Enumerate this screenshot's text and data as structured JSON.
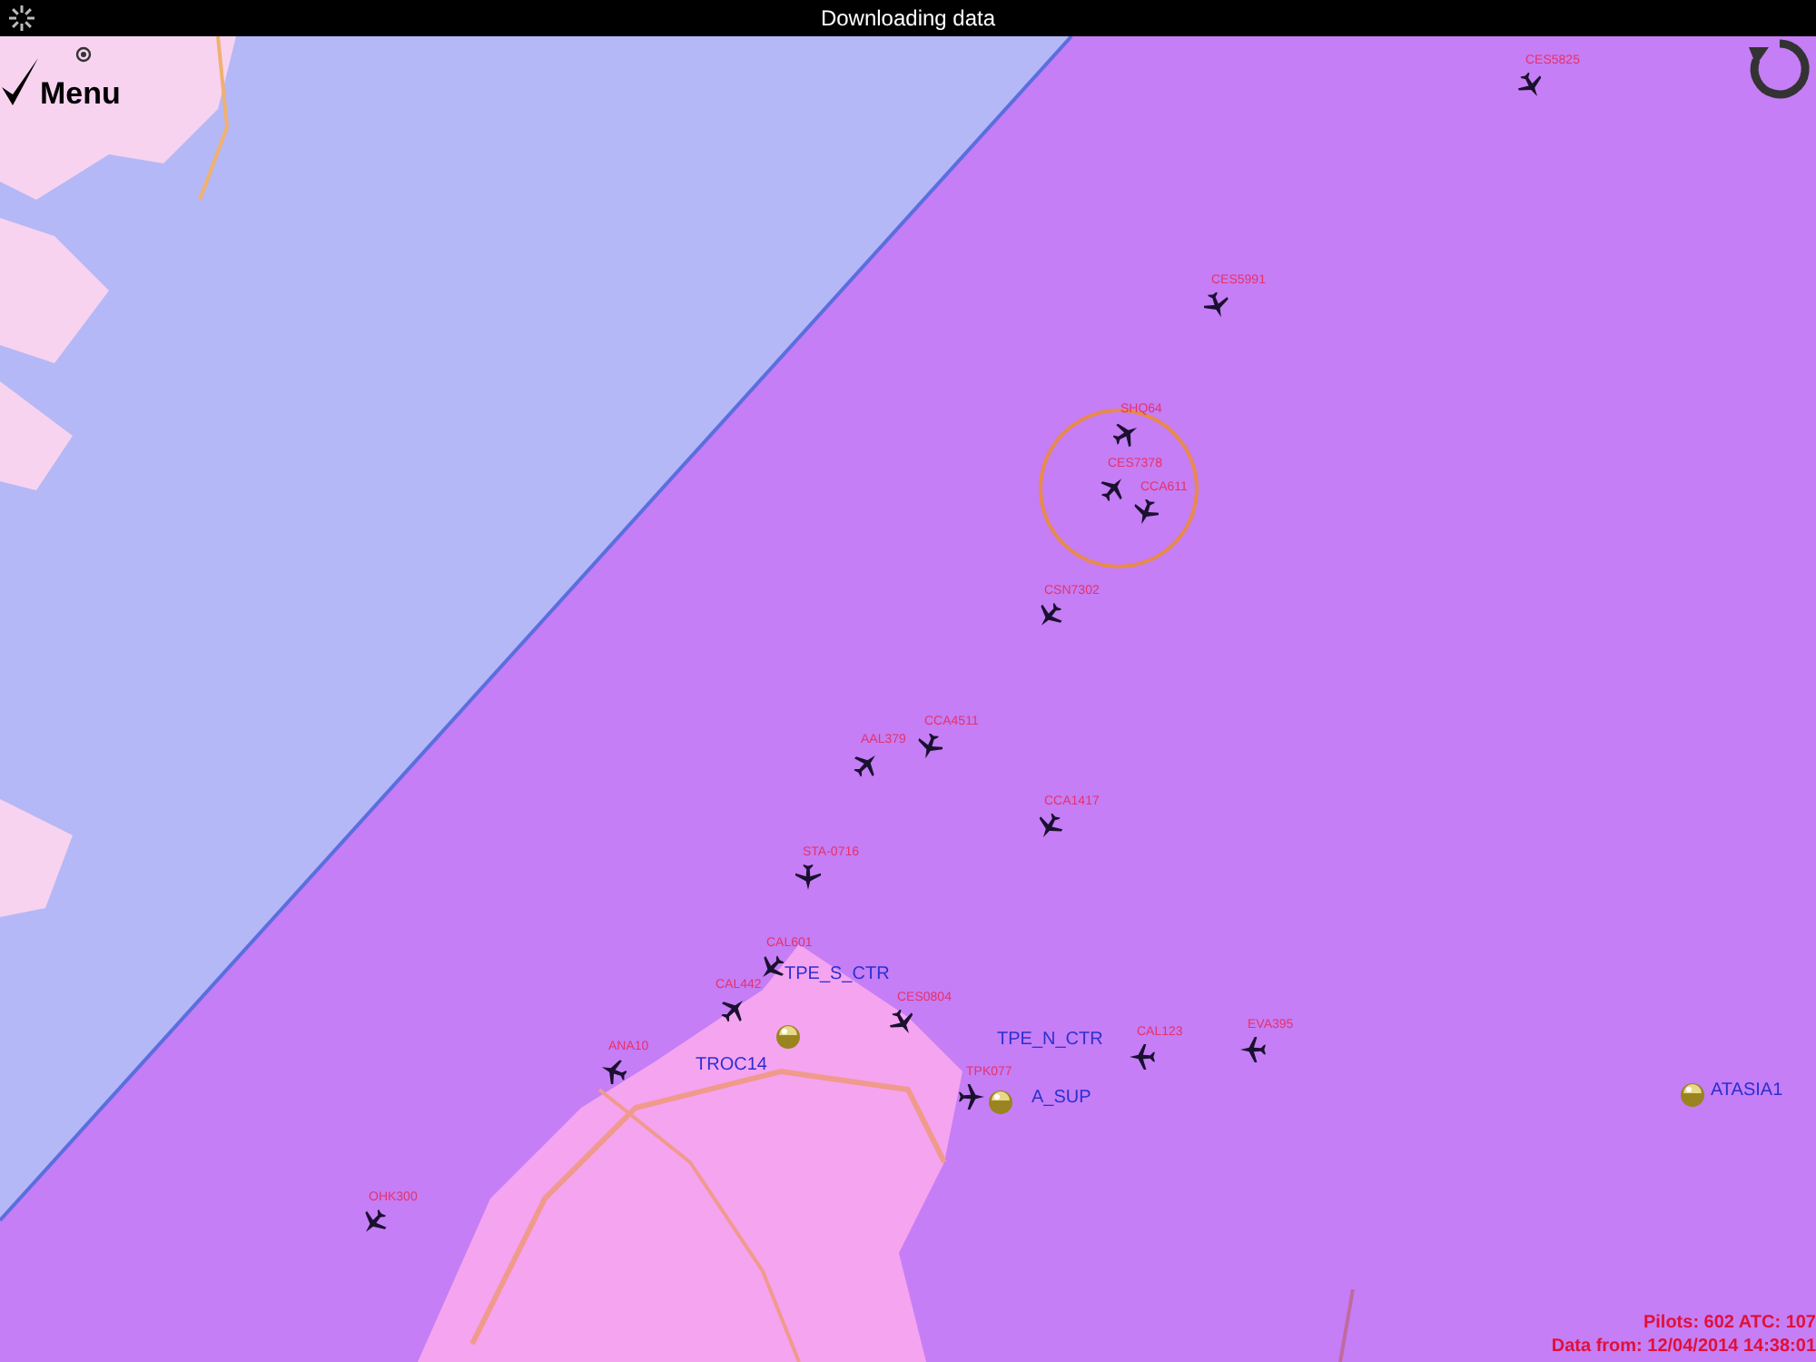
{
  "status_bar": {
    "title": "Downloading data",
    "loading": true
  },
  "menu": {
    "label": "Menu"
  },
  "flights": [
    {
      "callsign": "CES5825"
    },
    {
      "callsign": "CES5991"
    },
    {
      "callsign": "SHQ64"
    },
    {
      "callsign": "CES7378"
    },
    {
      "callsign": "CCA611"
    },
    {
      "callsign": "CSN7302"
    },
    {
      "callsign": "CCA4511"
    },
    {
      "callsign": "AAL379"
    },
    {
      "callsign": "CCA1417"
    },
    {
      "callsign": "STA-0716"
    },
    {
      "callsign": "CAL601"
    },
    {
      "callsign": "CAL442"
    },
    {
      "callsign": "CES0804"
    },
    {
      "callsign": "CAL123"
    },
    {
      "callsign": "EVA395"
    },
    {
      "callsign": "TPK077"
    },
    {
      "callsign": "ANA10"
    },
    {
      "callsign": "OHK300"
    }
  ],
  "atc": [
    {
      "label": "TPE_S_CTR",
      "kind": "text"
    },
    {
      "label": "TPE_N_CTR",
      "kind": "text"
    },
    {
      "label": "TROC14",
      "kind": "text"
    },
    {
      "label": "A_SUP",
      "kind": "globe"
    },
    {
      "label": "ATASIA1",
      "kind": "globe"
    }
  ],
  "footer": {
    "pilots": "Pilots: 602 ATC: 107",
    "data_from": "Data from: 12/04/2014 14:38:01"
  }
}
